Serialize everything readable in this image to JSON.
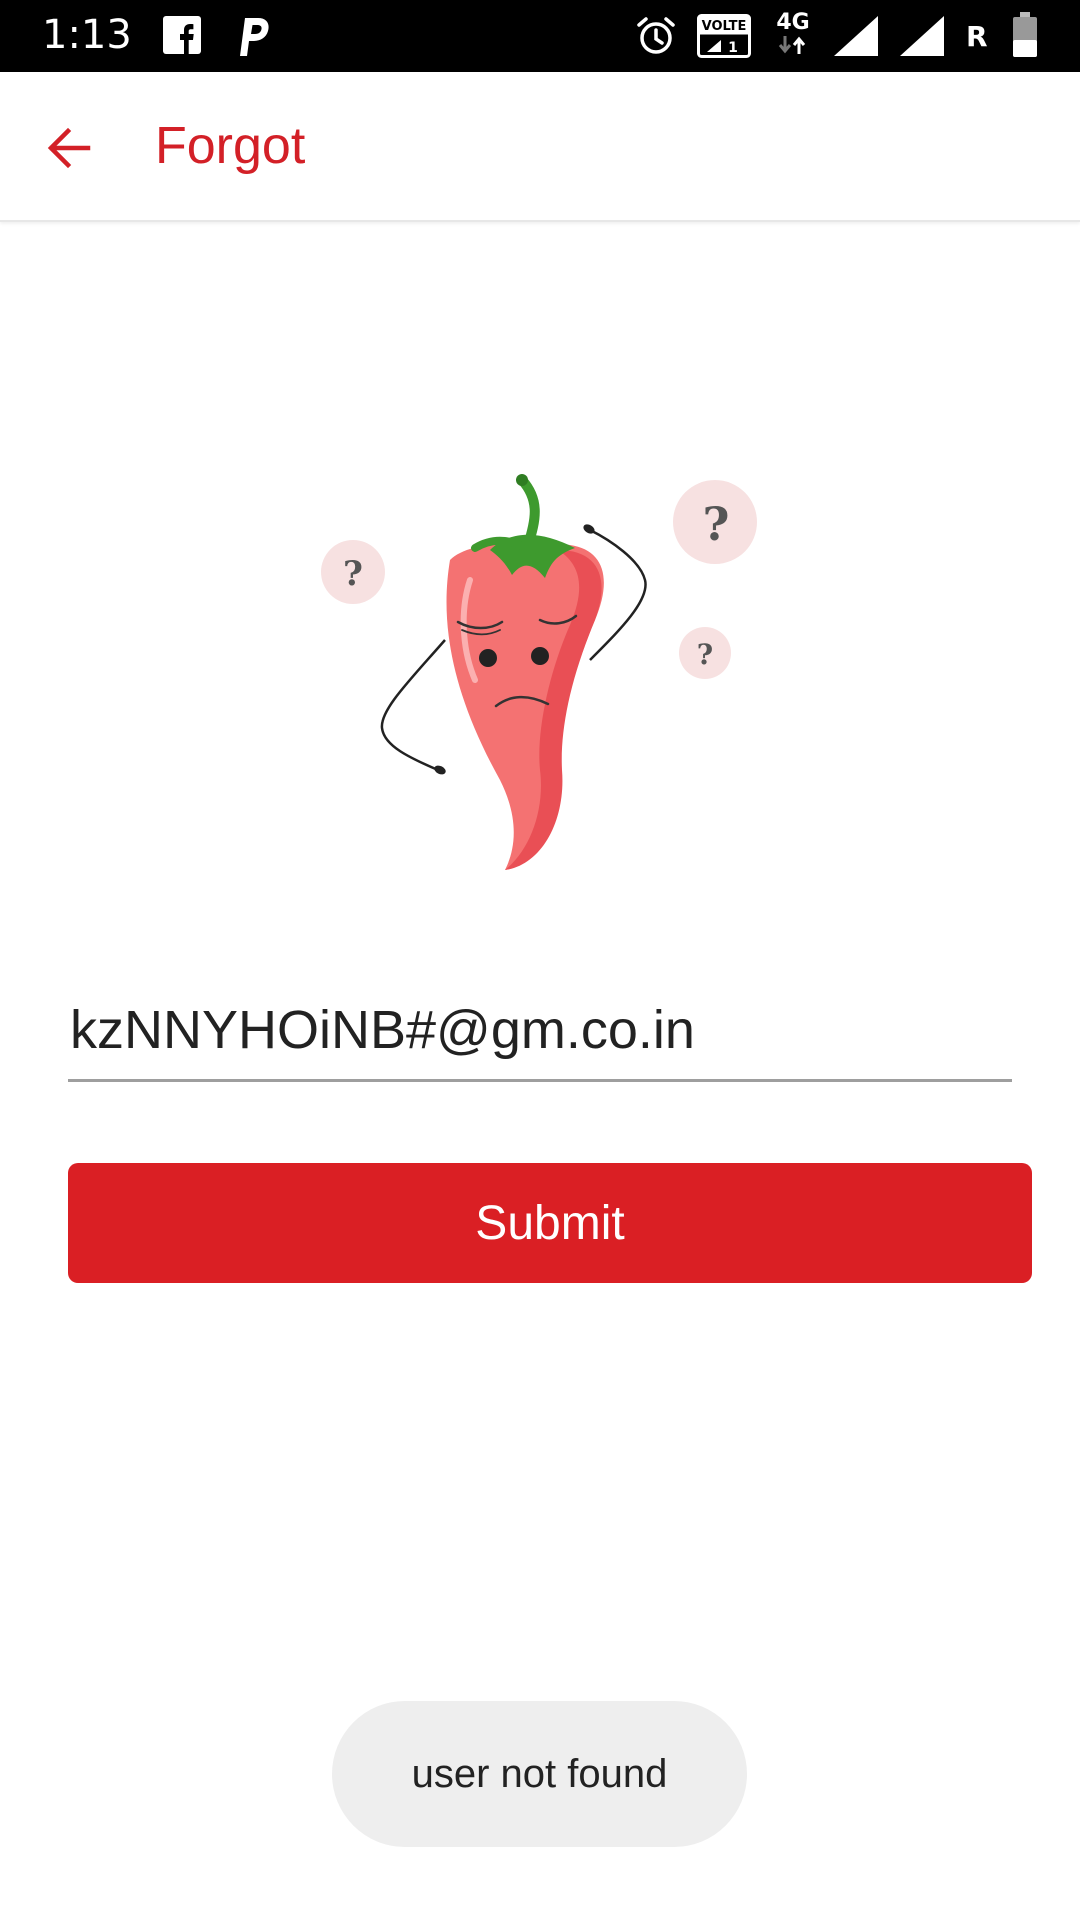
{
  "status_bar": {
    "time": "1:13",
    "left_icons": [
      "facebook-icon",
      "paytm-p-icon"
    ],
    "right_icons": [
      "alarm-icon",
      "volte-icon",
      "network-4g-icon",
      "signal-icon",
      "signal-icon",
      "roaming-icon",
      "battery-icon"
    ],
    "network_label": "4G",
    "volte_label": "VOLTE",
    "roaming_label": "R"
  },
  "header": {
    "title": "Forgot",
    "back_icon": "arrow-left-icon"
  },
  "form": {
    "email_value": "kzNNYHOiNB#@gm.co.in",
    "submit_label": "Submit"
  },
  "toast": {
    "message": "user not found"
  },
  "colors": {
    "accent": "#da1f24",
    "title": "#d32027",
    "status_bar": "#000000",
    "toast_bg": "#eeeeee"
  }
}
